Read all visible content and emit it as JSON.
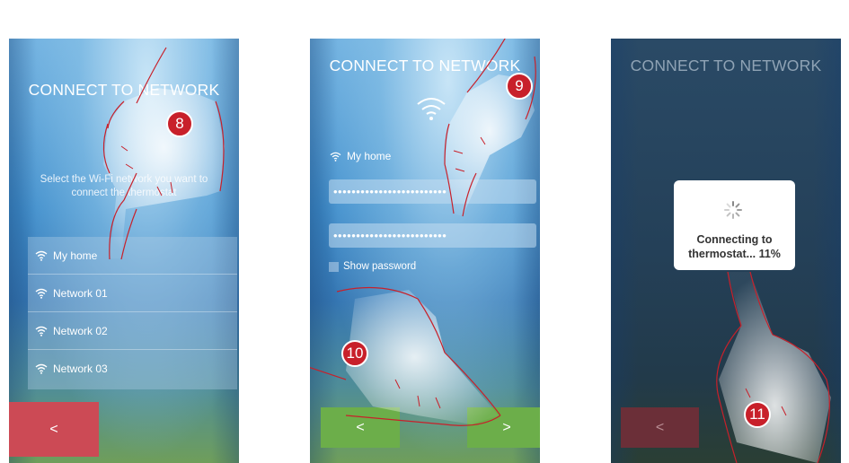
{
  "screen1": {
    "title": "CONNECT TO NETWORK",
    "subtitle_line1": "Select the Wi-Fi network you want to",
    "subtitle_line2": "connect the thermostat",
    "networks": [
      {
        "name": "My home",
        "icon": "wifi-icon"
      },
      {
        "name": "Network 01",
        "icon": "wifi-icon"
      },
      {
        "name": "Network 02",
        "icon": "wifi-icon"
      },
      {
        "name": "Network 03",
        "icon": "wifi-icon"
      }
    ],
    "back_label": "<",
    "step_badge": "8"
  },
  "screen2": {
    "title": "CONNECT TO NETWORK",
    "network_name": "My home",
    "password_masked": "•••••••••••••••••••••••••",
    "confirm_masked": "•••••••••••••••••••••••••",
    "show_password_label": "Show password",
    "back_label": "<",
    "next_label": ">",
    "step_badge_1": "9",
    "step_badge_2": "10"
  },
  "screen3": {
    "title": "CONNECT TO NETWORK",
    "dialog_line1": "Connecting to",
    "dialog_line2": "thermostat... 11%",
    "progress_percent": 11,
    "back_label": "<",
    "step_badge": "11"
  },
  "colors": {
    "back_red": "#cc4a55",
    "nav_green": "#6cae4a",
    "back_dark": "#6b2f38",
    "badge_red": "#c8202a"
  }
}
